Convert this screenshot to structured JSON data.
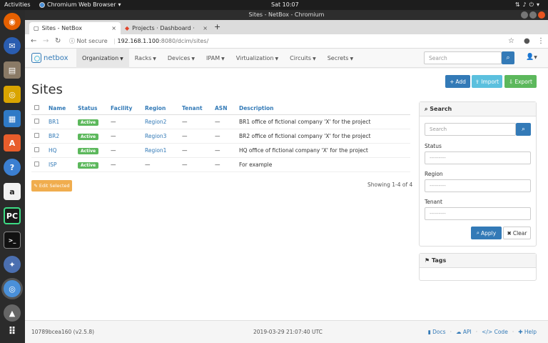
{
  "os": {
    "activities": "Activities",
    "app_name": "Chromium Web Browser",
    "clock": "Sat 10:07"
  },
  "window": {
    "title": "Sites - NetBox - Chromium"
  },
  "tabs": [
    {
      "label": "Sites - NetBox",
      "close": "×"
    },
    {
      "label": "Projects · Dashboard · Git",
      "close": "×"
    }
  ],
  "address": {
    "security": "Not secure",
    "host": "192.168.1.100",
    "path": ":8080/dcim/sites/"
  },
  "navbar": {
    "brand": "netbox",
    "menu": [
      "Organization",
      "Racks",
      "Devices",
      "IPAM",
      "Virtualization",
      "Circuits",
      "Secrets"
    ],
    "search_placeholder": "Search"
  },
  "page": {
    "title": "Sites",
    "buttons": {
      "add": "Add",
      "import": "Import",
      "export": "Export"
    },
    "columns": [
      "Name",
      "Status",
      "Facility",
      "Region",
      "Tenant",
      "ASN",
      "Description"
    ],
    "rows": [
      {
        "name": "BR1",
        "status": "Active",
        "facility": "—",
        "region": "Region2",
        "tenant": "—",
        "asn": "—",
        "description": "BR1 office of fictional company 'X' for the project"
      },
      {
        "name": "BR2",
        "status": "Active",
        "facility": "—",
        "region": "Region3",
        "tenant": "—",
        "asn": "—",
        "description": "BR2 office of fictional company 'X' for the project"
      },
      {
        "name": "HQ",
        "status": "Active",
        "facility": "—",
        "region": "Region1",
        "tenant": "—",
        "asn": "—",
        "description": "HQ office of fictional company 'X' for the project"
      },
      {
        "name": "ISP",
        "status": "Active",
        "facility": "—",
        "region": "—",
        "tenant": "—",
        "asn": "—",
        "description": "For example"
      }
    ],
    "edit_selected": "Edit Selected",
    "showing": "Showing 1-4 of 4"
  },
  "search_panel": {
    "heading": "Search",
    "search_placeholder": "Search",
    "status_label": "Status",
    "region_label": "Region",
    "tenant_label": "Tenant",
    "empty_option": "---------",
    "apply": "Apply",
    "clear": "Clear"
  },
  "tags_panel": {
    "heading": "Tags"
  },
  "footer": {
    "version": "10789bcea160 (v2.5.8)",
    "timestamp": "2019-03-29 21:07:40 UTC",
    "links": [
      "Docs",
      "API",
      "Code",
      "Help"
    ]
  }
}
